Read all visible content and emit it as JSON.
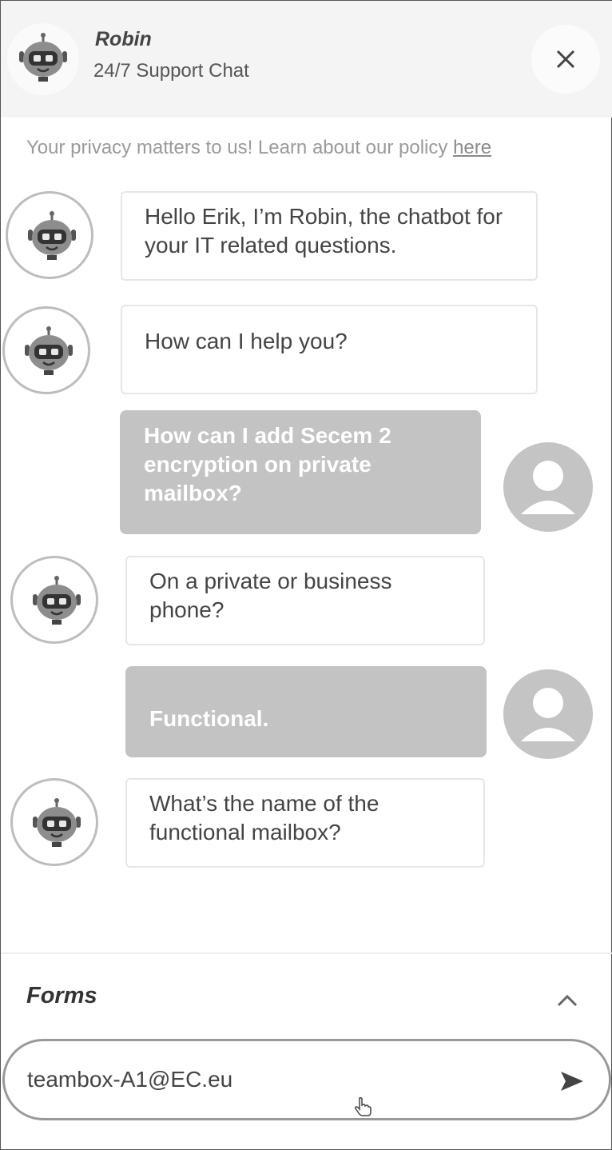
{
  "header": {
    "bot_name": "Robin",
    "subtitle": "24/7 Support Chat",
    "close_icon": "close-icon"
  },
  "privacy": {
    "text": "Your privacy matters to us! Learn about our policy ",
    "link": "here"
  },
  "messages": [
    {
      "from": "bot",
      "text": "Hello Erik, I’m Robin, the chatbot for your IT related questions."
    },
    {
      "from": "bot",
      "text": "How can I help you?"
    },
    {
      "from": "user",
      "text": "How can I add Secem 2 encryption on private mailbox?"
    },
    {
      "from": "bot",
      "text": "On a private or business phone?"
    },
    {
      "from": "user",
      "text": "Functional."
    },
    {
      "from": "bot",
      "text": "What’s the name of the functional mailbox?"
    }
  ],
  "forms": {
    "label": "Forms",
    "toggle_icon": "chevron-up-icon"
  },
  "input": {
    "value": "teambox-A1@EC.eu",
    "send_icon": "send-icon"
  },
  "colors": {
    "user_bubble": "#c3c3c3",
    "bot_bubble_border": "#e6e6e6",
    "header_bg": "#f4f4f4"
  }
}
